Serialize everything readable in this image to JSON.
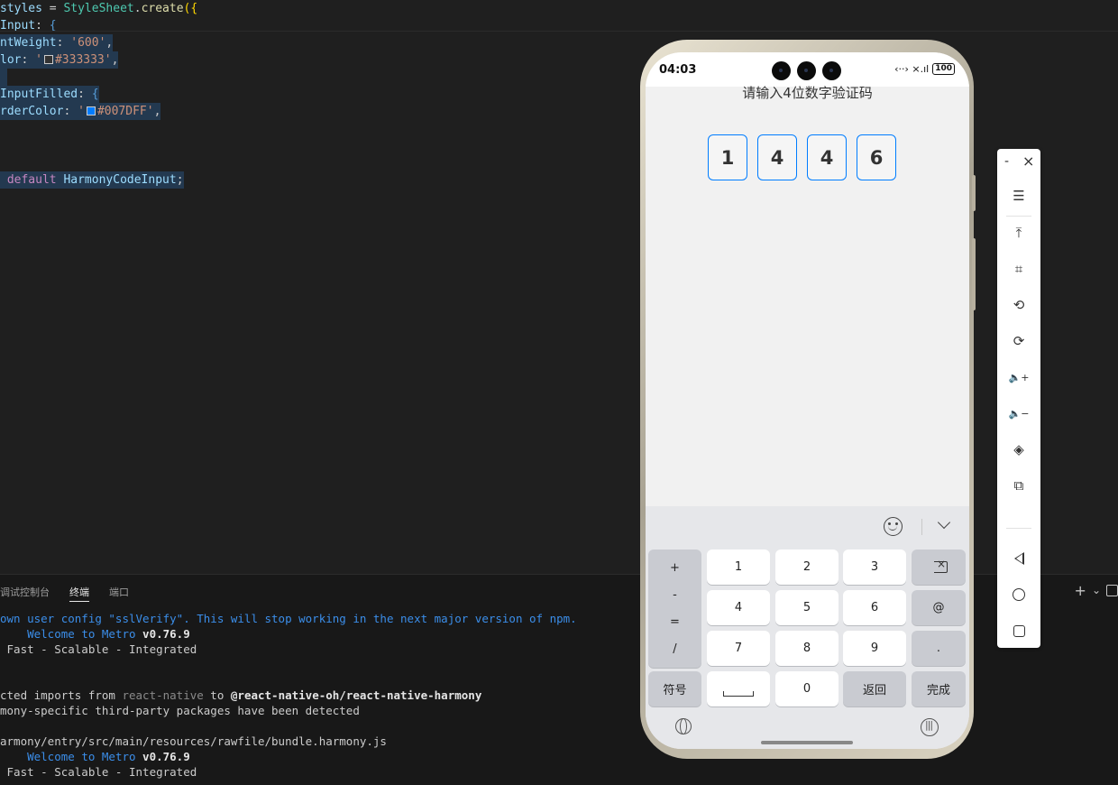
{
  "editor": {
    "lines": [
      {
        "parts": [
          {
            "c": "id",
            "t": "styles"
          },
          {
            "c": "pl",
            "t": " = "
          },
          {
            "c": "cls",
            "t": "StyleSheet"
          },
          {
            "c": "pl",
            "t": "."
          },
          {
            "c": "fn",
            "t": "create"
          },
          {
            "c": "br",
            "t": "({"
          }
        ]
      },
      {
        "parts": [
          {
            "c": "id",
            "t": "Input"
          },
          {
            "c": "pl",
            "t": ": "
          },
          {
            "c": "ty",
            "t": "{"
          }
        ]
      },
      {
        "parts": [
          {
            "c": "id",
            "t": "ntWeight"
          },
          {
            "c": "pl",
            "t": ": "
          },
          {
            "c": "str",
            "t": "'600'"
          },
          {
            "c": "pl",
            "t": ","
          }
        ],
        "sel": true
      },
      {
        "parts": [
          {
            "c": "id",
            "t": "lor"
          },
          {
            "c": "pl",
            "t": ": "
          },
          {
            "c": "str",
            "t": "'"
          },
          {
            "c": "swatch",
            "t": "#333333"
          },
          {
            "c": "str",
            "t": "#333333'"
          },
          {
            "c": "pl",
            "t": ","
          }
        ],
        "sel": true
      },
      {
        "parts": [
          {
            "c": "pl",
            "t": " "
          }
        ],
        "sel": true
      },
      {
        "parts": [
          {
            "c": "id",
            "t": "InputFilled"
          },
          {
            "c": "pl",
            "t": ": "
          },
          {
            "c": "ty",
            "t": "{"
          }
        ],
        "sel": true
      },
      {
        "parts": [
          {
            "c": "id",
            "t": "rderColor"
          },
          {
            "c": "pl",
            "t": ": "
          },
          {
            "c": "str",
            "t": "'"
          },
          {
            "c": "swatch",
            "t": "#007DFF"
          },
          {
            "c": "str",
            "t": "#007DFF'"
          },
          {
            "c": "pl",
            "t": ","
          }
        ],
        "sel": true
      },
      {
        "parts": [
          {
            "c": "pl",
            "t": " "
          }
        ]
      },
      {
        "parts": [
          {
            "c": "pl",
            "t": " "
          }
        ]
      },
      {
        "parts": [
          {
            "c": "pl",
            "t": " "
          }
        ]
      },
      {
        "parts": [
          {
            "c": "pl",
            "t": " "
          },
          {
            "c": "kw",
            "t": "default"
          },
          {
            "c": "pl",
            "t": " "
          },
          {
            "c": "id",
            "t": "HarmonyCodeInput"
          },
          {
            "c": "pl",
            "t": ";"
          }
        ],
        "sel": true
      }
    ]
  },
  "panel": {
    "tabs": [
      {
        "label": "调试控制台",
        "active": false
      },
      {
        "label": "终端",
        "active": true
      },
      {
        "label": "端口",
        "active": false
      }
    ],
    "add_icon": "+",
    "dropdown_icon": "⌄",
    "terminal_lines": [
      {
        "parts": [
          {
            "c": "warn",
            "t": "own user config \"sslVerify\". This will stop working in the next major version of npm."
          }
        ]
      },
      {
        "parts": [
          {
            "c": "pl",
            "t": "    "
          },
          {
            "c": "metro",
            "t": "Welcome to Metro "
          },
          {
            "c": "b",
            "t": "v0.76.9"
          }
        ]
      },
      {
        "parts": [
          {
            "c": "pl",
            "t": " Fast - Scalable - Integrated"
          }
        ]
      },
      {
        "parts": [
          {
            "c": "pl",
            "t": " "
          }
        ]
      },
      {
        "parts": [
          {
            "c": "pl",
            "t": " "
          }
        ]
      },
      {
        "parts": [
          {
            "c": "pl",
            "t": "cted imports from "
          },
          {
            "c": "dim",
            "t": "react-native"
          },
          {
            "c": "pl",
            "t": " to "
          },
          {
            "c": "b",
            "t": "@react-native-oh/react-native-harmony"
          }
        ]
      },
      {
        "parts": [
          {
            "c": "pl",
            "t": "mony-specific third-party packages have been detected"
          }
        ]
      },
      {
        "parts": [
          {
            "c": "pl",
            "t": " "
          }
        ]
      },
      {
        "parts": [
          {
            "c": "pl",
            "t": "armony/entry/src/main/resources/rawfile/bundle.harmony.js"
          }
        ]
      },
      {
        "parts": [
          {
            "c": "pl",
            "t": "    "
          },
          {
            "c": "metro",
            "t": "Welcome to Metro "
          },
          {
            "c": "b",
            "t": "v0.76.9"
          }
        ]
      },
      {
        "parts": [
          {
            "c": "pl",
            "t": " Fast - Scalable - Integrated"
          }
        ]
      }
    ]
  },
  "phone": {
    "status": {
      "time": "04:03",
      "signal": "‹··› ×.ıl",
      "battery": "100"
    },
    "prompt": "请输入4位数字验证码",
    "code_digits": [
      "1",
      "4",
      "4",
      "6"
    ],
    "code_border_color": "#007DFF",
    "keyboard": {
      "symbols": [
        "+",
        "-",
        "=",
        "/"
      ],
      "digits": [
        "1",
        "2",
        "3",
        "4",
        "5",
        "6",
        "7",
        "8",
        "9"
      ],
      "zero": "0",
      "at": "@",
      "dot": ".",
      "symbol_key": "符号",
      "back_key": "返回",
      "done_key": "完成",
      "icons": [
        "emoji-icon",
        "collapse-keyboard-icon",
        "backspace-icon",
        "globe-icon",
        "voice-icon"
      ]
    }
  },
  "toolbar": {
    "min": "-",
    "close": "×",
    "items": [
      {
        "name": "menu-icon",
        "glyph": "☰"
      },
      {
        "name": "pin-top-icon",
        "glyph": "⤒"
      },
      {
        "name": "screenshot-crop-icon",
        "glyph": "⌗"
      },
      {
        "name": "rotate-left-icon",
        "glyph": "⟲"
      },
      {
        "name": "rotate-right-icon",
        "glyph": "⟳"
      },
      {
        "name": "volume-up-icon",
        "glyph": "🔈+"
      },
      {
        "name": "volume-down-icon",
        "glyph": "🔈−"
      },
      {
        "name": "shake-icon",
        "glyph": "◈"
      },
      {
        "name": "multi-device-icon",
        "glyph": "⧉"
      }
    ]
  }
}
